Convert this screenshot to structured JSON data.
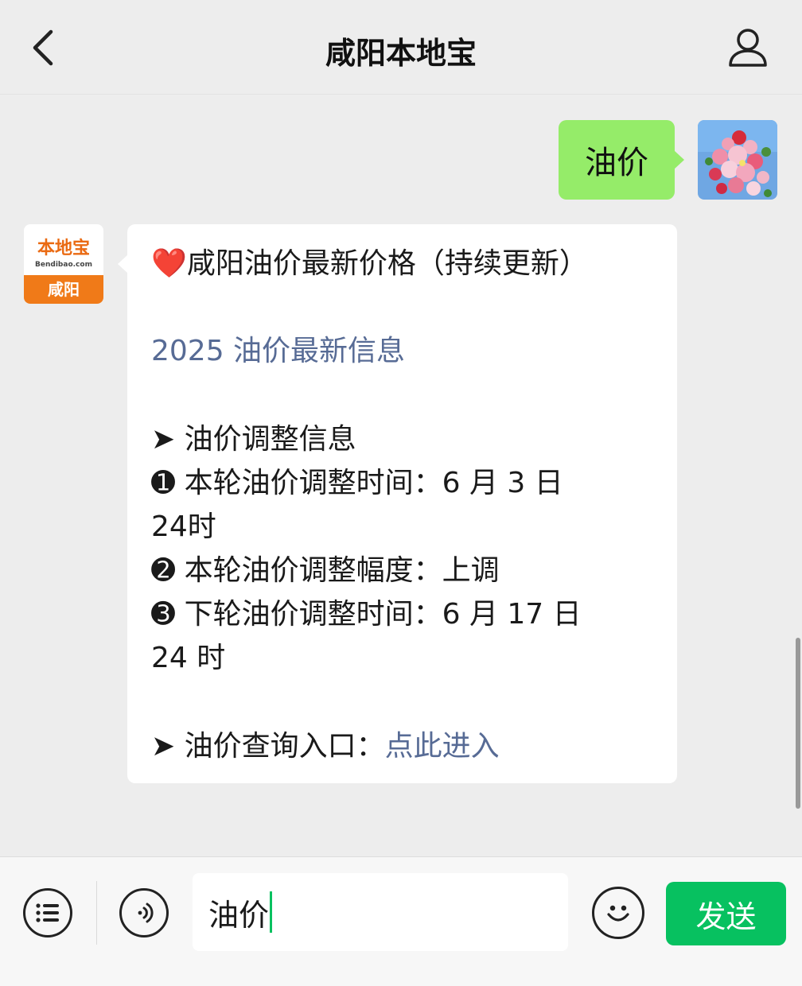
{
  "header": {
    "title": "咸阳本地宝",
    "back_icon": "chevron-left-icon",
    "profile_icon": "person-icon"
  },
  "chat": {
    "user_message": "油价",
    "bot": {
      "logo_main": "本地宝",
      "logo_sub": "Bendibao.com",
      "logo_city": "咸阳"
    },
    "reply": {
      "title_emoji": "❤️",
      "title": "咸阳油价最新价格（持续更新）",
      "subtitle": "2025 油价最新信息",
      "section_heading": "➤ 油价调整信息",
      "item1_line1": "➊ 本轮油价调整时间：6 月 3 日",
      "item1_line2": "24时",
      "item2": "➋ 本轮油价调整幅度：上调",
      "item3_line1": "➌ 下轮油价调整时间：6 月 17 日",
      "item3_line2": "24 时",
      "query_label": "➤ 油价查询入口：",
      "query_link": "点此进入"
    }
  },
  "input_bar": {
    "menu_icon": "list-menu-icon",
    "voice_icon": "voice-icon",
    "input_value": "油价",
    "emoji_icon": "smiley-icon",
    "send_label": "发送"
  },
  "colors": {
    "accent": "#07c160",
    "user_bubble": "#95ec69",
    "link": "#576b95",
    "logo_orange": "#f07a18"
  }
}
